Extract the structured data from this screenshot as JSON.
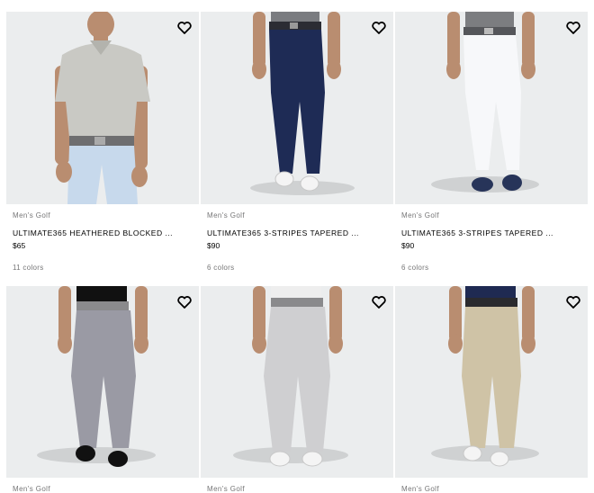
{
  "products": [
    {
      "category": "Men's Golf",
      "name": "ULTIMATE365 HEATHERED BLOCKED ...",
      "price": "$65",
      "colors": "11 colors",
      "item": "heathered polo shirt with light blue pants"
    },
    {
      "category": "Men's Golf",
      "name": "ULTIMATE365 3-STRIPES TAPERED ...",
      "price": "$90",
      "colors": "6 colors",
      "item": "navy tapered golf pants"
    },
    {
      "category": "Men's Golf",
      "name": "ULTIMATE365 3-STRIPES TAPERED ...",
      "price": "$90",
      "colors": "6 colors",
      "item": "white tapered golf pants"
    },
    {
      "category": "Men's Golf",
      "item": "grey heathered golf pants"
    },
    {
      "category": "Men's Golf",
      "item": "light grey golf pants"
    },
    {
      "category": "Men's Golf",
      "item": "khaki golf pants"
    }
  ],
  "icons": {
    "wishlist": "heart-outline-icon"
  },
  "colors": {
    "tile_background": "#ebedee",
    "muted_text": "#767677",
    "text": "#000000"
  }
}
